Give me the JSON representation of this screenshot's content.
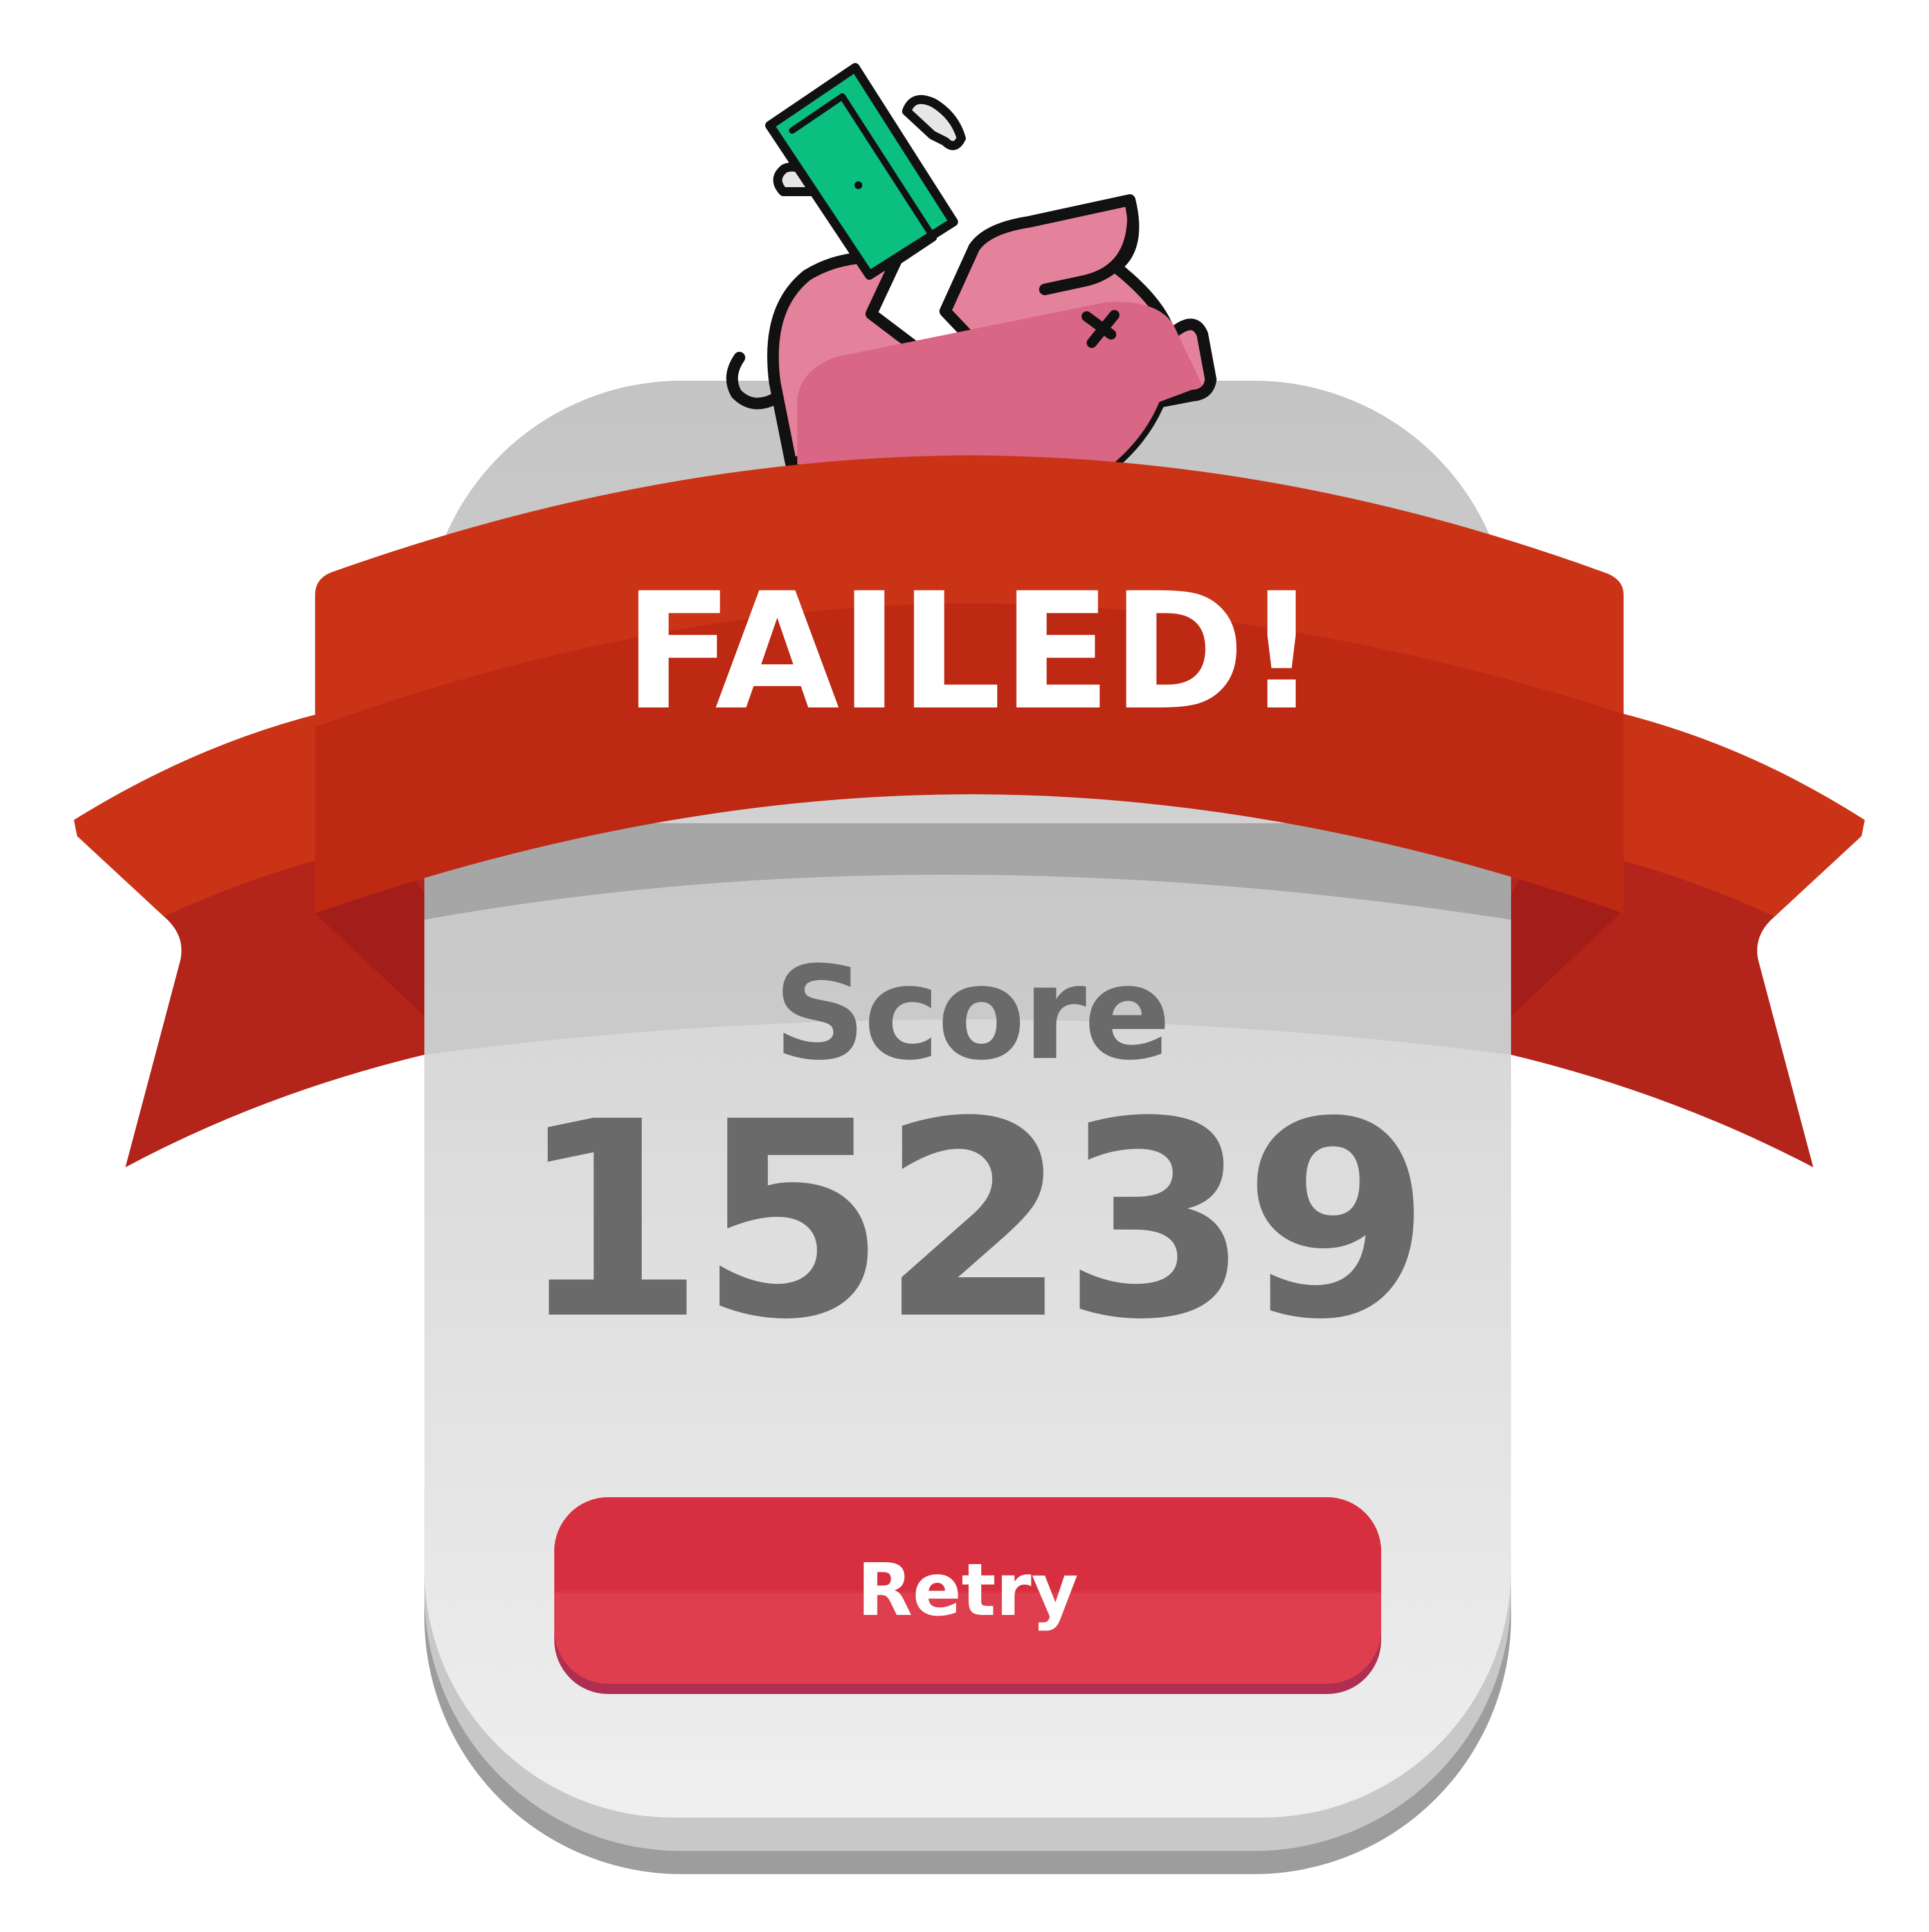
{
  "banner": {
    "title": "FAILED!"
  },
  "result": {
    "score_label": "Score",
    "score_value": "15239"
  },
  "actions": {
    "retry_label": "Retry"
  },
  "colors": {
    "ribbon": "#cb3317",
    "ribbon_dark": "#b2251a",
    "panel": "#d8d8d8",
    "score_text": "#6a6a6a",
    "button": "#d82f40",
    "pig": "#e5829b",
    "bill": "#0bbf80"
  },
  "icons": [
    "broken-piggy-bank-icon",
    "flying-money-icon"
  ]
}
